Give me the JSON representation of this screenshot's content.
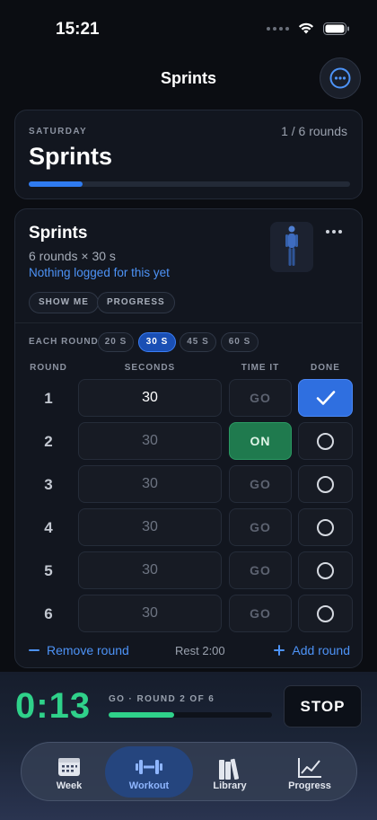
{
  "status_bar": {
    "time": "15:21"
  },
  "nav": {
    "title": "Sprints"
  },
  "summary": {
    "day": "SATURDAY",
    "rounds": "1 / 6 rounds",
    "title": "Sprints",
    "progress_fraction": 0.167
  },
  "exercise": {
    "name": "Sprints",
    "detail": "6 rounds × 30 s",
    "note": "Nothing logged for this yet",
    "chips": {
      "show_me": "SHOW ME",
      "progress": "PROGRESS"
    },
    "each_round_label": "EACH ROUND",
    "durations": [
      "20 S",
      "30 S",
      "45 S",
      "60 S"
    ],
    "selected_duration": "30 S",
    "headers": {
      "round": "ROUND",
      "seconds": "SECONDS",
      "time_it": "TIME IT",
      "done": "DONE"
    },
    "rows": [
      {
        "round": "1",
        "seconds": "30",
        "time_it": "GO",
        "done": true
      },
      {
        "round": "2",
        "seconds": "30",
        "time_it": "ON",
        "done": false
      },
      {
        "round": "3",
        "seconds": "30",
        "time_it": "GO",
        "done": false
      },
      {
        "round": "4",
        "seconds": "30",
        "time_it": "GO",
        "done": false
      },
      {
        "round": "5",
        "seconds": "30",
        "time_it": "GO",
        "done": false
      },
      {
        "round": "6",
        "seconds": "30",
        "time_it": "GO",
        "done": false
      }
    ],
    "remove_round": "Remove round",
    "rest": "Rest 2:00",
    "add_round": "Add round"
  },
  "timer": {
    "value": "0:13",
    "status": "GO · ROUND 2 OF 6",
    "progress_fraction": 0.4,
    "stop_label": "STOP"
  },
  "tabs": [
    {
      "label": "Week",
      "icon": "calendar-icon",
      "active": false
    },
    {
      "label": "Workout",
      "icon": "dumbbell-icon",
      "active": true
    },
    {
      "label": "Library",
      "icon": "books-icon",
      "active": false
    },
    {
      "label": "Progress",
      "icon": "chart-icon",
      "active": false
    }
  ],
  "colors": {
    "accent_blue": "#2f7bf0",
    "timer_green": "#2fd18a",
    "on_green": "#1f7a4e"
  }
}
